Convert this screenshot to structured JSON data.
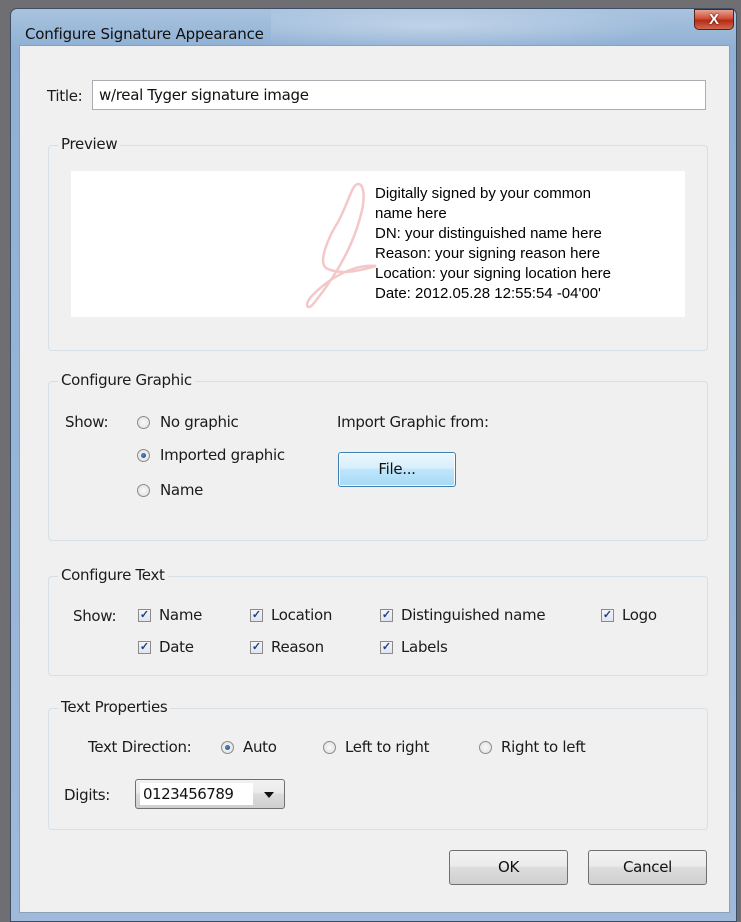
{
  "window": {
    "title": "Configure Signature Appearance",
    "close_glyph": "X"
  },
  "title_field": {
    "label": "Title:",
    "value": "w/real Tyger signature image"
  },
  "preview": {
    "group_label": "Preview",
    "lines": [
      "Digitally signed by your common",
      "name here",
      "DN: your distinguished name here",
      "Reason: your signing reason here",
      "Location: your signing location here",
      "Date: 2012.05.28 12:55:54 -04'00'"
    ]
  },
  "configure_graphic": {
    "group_label": "Configure Graphic",
    "show_label": "Show:",
    "options": [
      {
        "label": "No graphic",
        "selected": false
      },
      {
        "label": "Imported graphic",
        "selected": true
      },
      {
        "label": "Name",
        "selected": false
      }
    ],
    "import_label": "Import Graphic from:",
    "file_button": "File..."
  },
  "configure_text": {
    "group_label": "Configure Text",
    "show_label": "Show:",
    "checkboxes": [
      {
        "label": "Name",
        "checked": true
      },
      {
        "label": "Location",
        "checked": true
      },
      {
        "label": "Distinguished name",
        "checked": true
      },
      {
        "label": "Logo",
        "checked": true
      },
      {
        "label": "Date",
        "checked": true
      },
      {
        "label": "Reason",
        "checked": true
      },
      {
        "label": "Labels",
        "checked": true
      }
    ]
  },
  "text_properties": {
    "group_label": "Text Properties",
    "direction_label": "Text Direction:",
    "direction_options": [
      {
        "label": "Auto",
        "selected": true
      },
      {
        "label": "Left to right",
        "selected": false
      },
      {
        "label": "Right to left",
        "selected": false
      }
    ],
    "digits_label": "Digits:",
    "digits_value": "0123456789"
  },
  "buttons": {
    "ok": "OK",
    "cancel": "Cancel"
  },
  "icons": {
    "check_glyph": "✓"
  },
  "colors": {
    "titlebar": "#9fbada",
    "client_bg": "#f0f0f0",
    "focus_button": "#bee6fd",
    "watermark": "#f4c8c8"
  }
}
